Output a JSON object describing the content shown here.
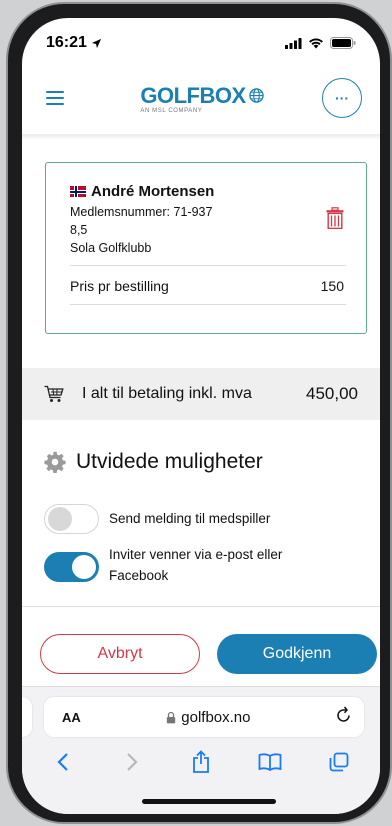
{
  "status_bar": {
    "time": "16:21"
  },
  "header": {
    "logo_text": "GOLFBOX",
    "logo_subtitle": "AN MSL COMPANY",
    "more_label": "···"
  },
  "player": {
    "name": "André Mortensen",
    "member_number": "Medlemsnummer: 71-937",
    "handicap": "8,5",
    "club": "Sola Golfklubb",
    "price_label": "Pris pr bestilling",
    "price_value": "150"
  },
  "total": {
    "label": "I alt til betaling inkl. mva",
    "amount": "450,00"
  },
  "options": {
    "title": "Utvidede muligheter",
    "send_message": {
      "label": "Send melding til medspiller",
      "enabled": false
    },
    "invite_friends": {
      "label": "Inviter venner via e-post eller Facebook",
      "enabled": true
    }
  },
  "actions": {
    "cancel": "Avbryt",
    "confirm": "Godkjenn"
  },
  "browser": {
    "text_size_label": "AA",
    "domain": "golfbox.no"
  },
  "colors": {
    "brand": "#1b7fb3",
    "cancel": "#d13a46",
    "card_border": "#5cae8a"
  },
  "icons": [
    "menu-icon",
    "more-icon",
    "norway-flag-icon",
    "trash-icon",
    "cart-icon",
    "gear-icon",
    "lock-icon",
    "reload-icon",
    "back-icon",
    "forward-icon",
    "share-icon",
    "bookmarks-icon",
    "tabs-icon"
  ]
}
